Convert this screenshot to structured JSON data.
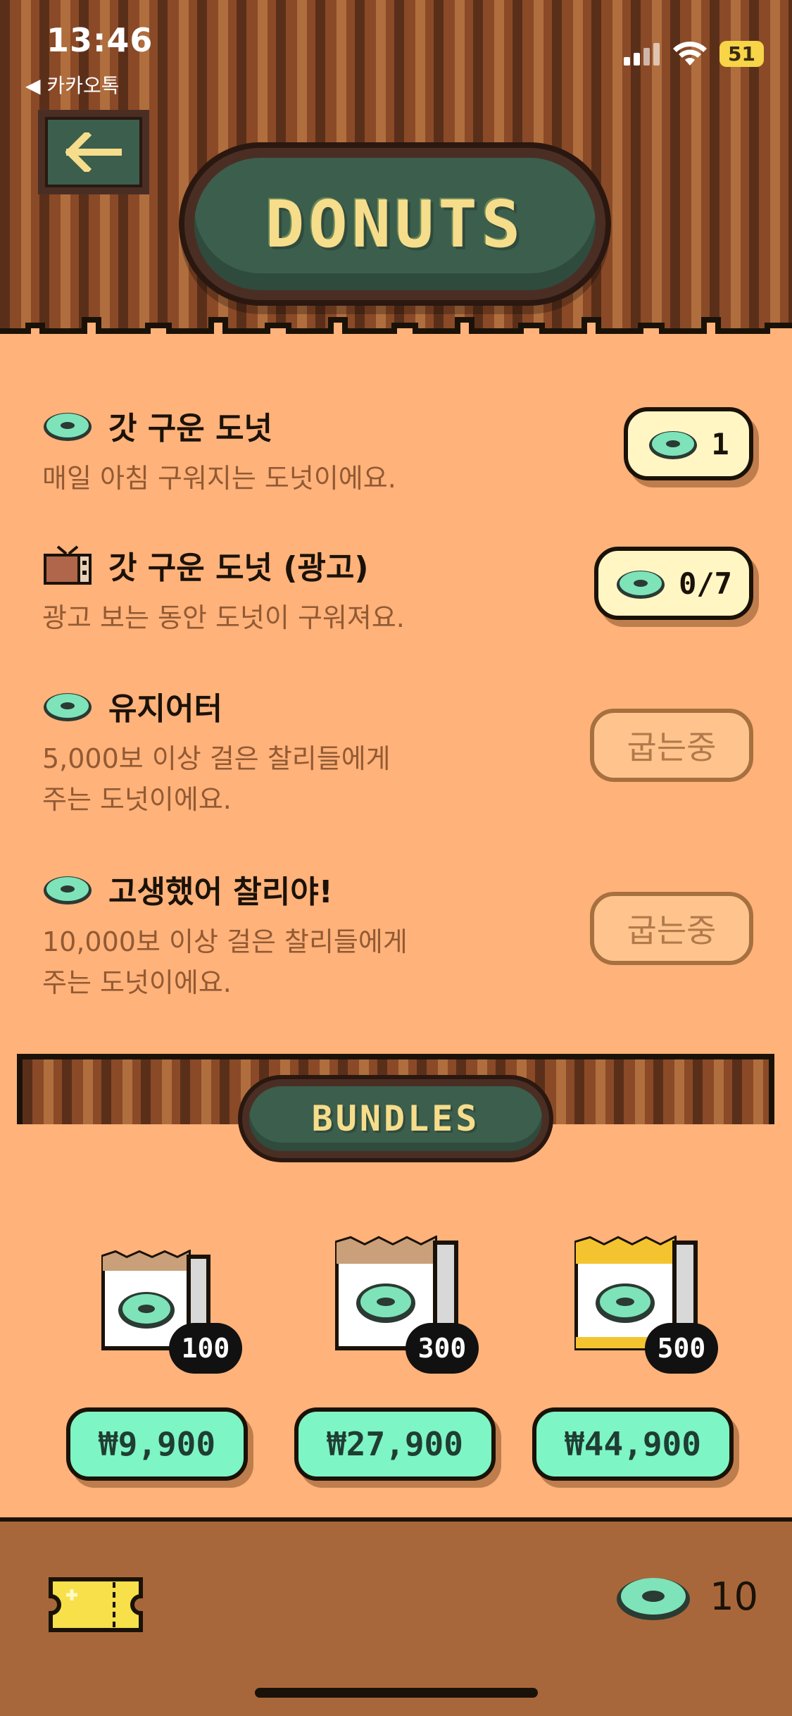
{
  "status_bar": {
    "time": "13:46",
    "back_app": "◀ 카카오톡",
    "battery": "51"
  },
  "header": {
    "title": "DONUTS"
  },
  "rewards": [
    {
      "title": "갓 구운 도넛",
      "desc": "매일 아침 구워지는 도넛이에요.",
      "button": "1",
      "icon": "donut-icon"
    },
    {
      "title": "갓 구운 도넛 (광고)",
      "desc": "광고 보는 동안 도넛이 구워져요.",
      "button": "0/7",
      "icon": "tv-icon"
    },
    {
      "title": "유지어터",
      "desc_line1": "5,000보 이상 걸은 찰리들에게",
      "desc_line2": "주는 도넛이에요.",
      "button": "굽는중",
      "icon": "donut-icon"
    },
    {
      "title": "고생했어 찰리야!",
      "desc_line1": "10,000보 이상 걸은 찰리들에게",
      "desc_line2": "주는 도넛이에요.",
      "button": "굽는중",
      "icon": "donut-icon"
    }
  ],
  "bundles": {
    "title": "BUNDLES",
    "items": [
      {
        "count": "100",
        "price": "₩9,900"
      },
      {
        "count": "300",
        "price": "₩27,900"
      },
      {
        "count": "500",
        "price": "₩44,900"
      }
    ]
  },
  "bottom": {
    "donut_count": "10"
  },
  "colors": {
    "mint": "#7ef5c4",
    "badge_green": "#3c5e4d",
    "cream": "#fff6c4",
    "background": "#ffb27a",
    "wood": "#8a4a27"
  }
}
